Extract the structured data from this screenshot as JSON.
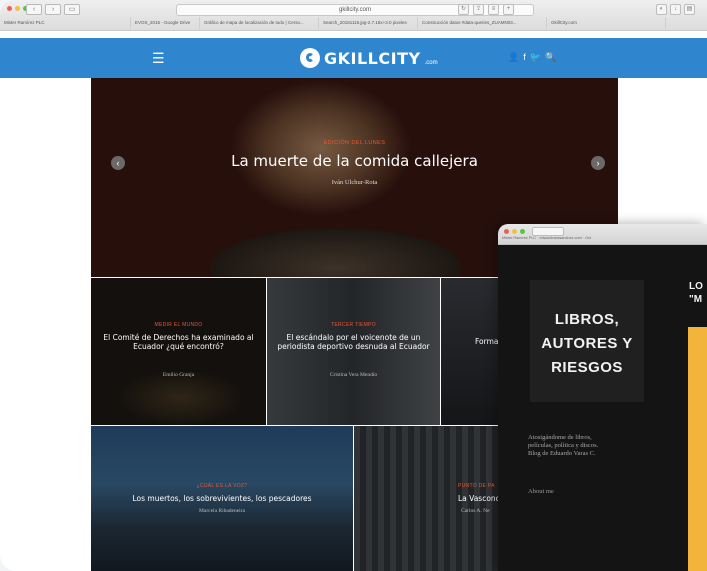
{
  "browser_main": {
    "url": "gkillcity.com",
    "tabs": [
      "Mister Ramírez PLC",
      "EVOS_2015 - Google Drive",
      "Gráfico de mapa de localización de todo | Cerso...",
      "Search_20181119.jpg-2.7.18x+3.0 pixeles",
      "Construcción datos #data-queries_ZUAMN03...",
      "GkillCity.com"
    ]
  },
  "site": {
    "logo_text": "GKILLCITY",
    "logo_suffix": ".com",
    "menu_icon": "☰",
    "social_icons": [
      "👤",
      "f",
      "🐦",
      "🔍"
    ]
  },
  "hero": {
    "kicker": "EDICIÓN DEL LUNES",
    "title": "La muerte de la comida callejera",
    "author": "Iván Ulchur-Rota",
    "prev": "‹",
    "next": "›"
  },
  "row1": [
    {
      "kicker": "MEDIR EL MUNDO",
      "title": "El Comité de Derechos ha examinado al Ecuador ¿qué encontró?",
      "author": "Emilio Granja"
    },
    {
      "kicker": "TERCER TIEMPO",
      "title": "El escándalo por el voicenote de un periodista deportivo desnuda al Ecuador",
      "author": "Cristina Vera Mendio"
    },
    {
      "kicker": "",
      "title": "Forma más a",
      "author": ""
    }
  ],
  "row2": [
    {
      "kicker": "¿CUÁL ES LA VOZ?",
      "title": "Los muertos, los sobrevivientes, los pescadores",
      "author": "Marcela Ribadeneira"
    },
    {
      "kicker": "PUNTO DE PA",
      "title": "La Vasconc",
      "author": "Carlos A. Ne"
    }
  ],
  "browser_second": {
    "tab": "Mister Ramírez PLC · edwardvarasanchez.com · Oct",
    "blog_title": [
      "LIBROS,",
      "AUTORES Y",
      "RIESGOS"
    ],
    "description": [
      "Atosigándome de libros,",
      "películas, política y discos.",
      "Blog de Eduardo Varas C."
    ],
    "about": "About me",
    "post_title": [
      "LO",
      "\"M"
    ]
  },
  "colors": {
    "brand_blue": "#2f86cf",
    "accent_red": "#e05a3a",
    "post_yellow": "#f2b43a"
  }
}
